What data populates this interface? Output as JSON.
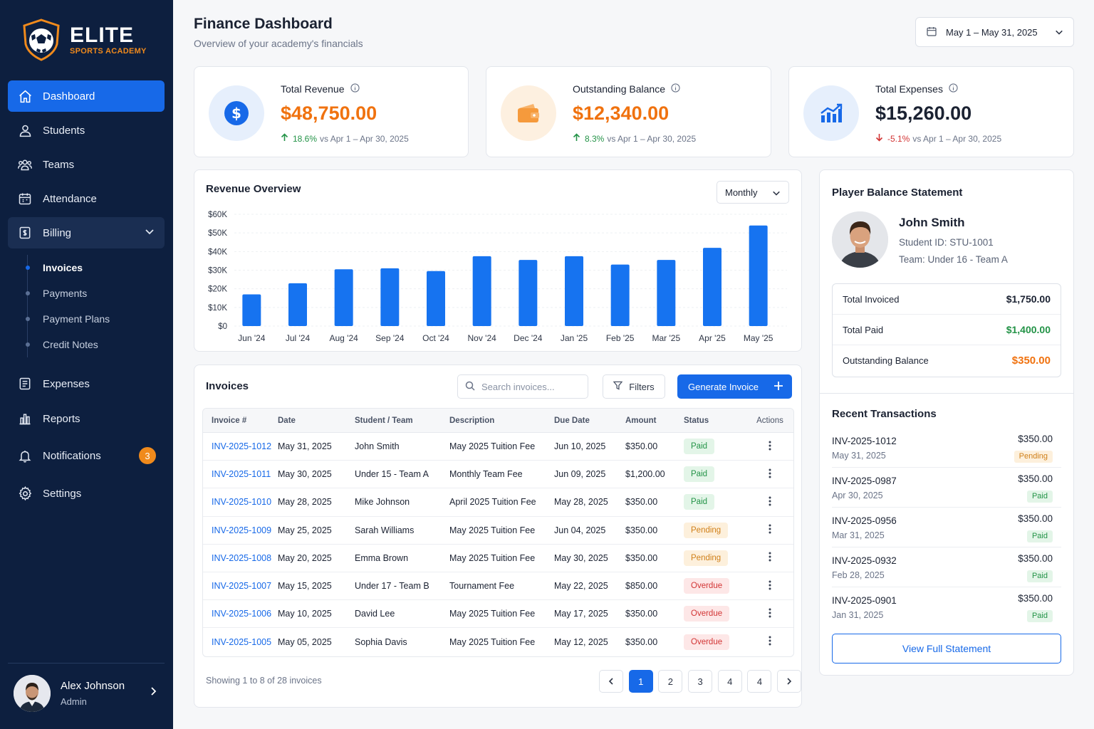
{
  "brand": {
    "name": "ELITE",
    "subtitle": "SPORTS ACADEMY"
  },
  "sidebar": {
    "items": [
      {
        "label": "Dashboard",
        "icon": "home-icon"
      },
      {
        "label": "Students",
        "icon": "user-icon"
      },
      {
        "label": "Teams",
        "icon": "users-icon"
      },
      {
        "label": "Attendance",
        "icon": "calendar-icon"
      },
      {
        "label": "Billing",
        "icon": "billing-icon"
      },
      {
        "label": "Expenses",
        "icon": "receipt-icon"
      },
      {
        "label": "Reports",
        "icon": "bar-chart-icon"
      },
      {
        "label": "Notifications",
        "icon": "bell-icon",
        "badge": "3"
      },
      {
        "label": "Settings",
        "icon": "gear-icon"
      }
    ],
    "billing_sub": [
      "Invoices",
      "Payments",
      "Payment Plans",
      "Credit Notes"
    ],
    "user": {
      "name": "Alex Johnson",
      "role": "Admin"
    }
  },
  "header": {
    "title": "Finance Dashboard",
    "subtitle": "Overview of your academy's financials",
    "date_range": "May 1 – May 31, 2025"
  },
  "stats": [
    {
      "label": "Total Revenue",
      "value": "$48,750.00",
      "change": "18.6%",
      "period": "vs Apr 1 – Apr 30, 2025",
      "direction": "up",
      "value_color": "#f0720f"
    },
    {
      "label": "Outstanding Balance",
      "value": "$12,340.00",
      "change": "8.3%",
      "period": "vs Apr 1 – Apr 30, 2025",
      "direction": "up",
      "value_color": "#f0720f"
    },
    {
      "label": "Total Expenses",
      "value": "$15,260.00",
      "change": "-5.1%",
      "period": "vs Apr 1 – Apr 30, 2025",
      "direction": "down",
      "value_color": "#1b2232"
    }
  ],
  "revenue": {
    "title": "Revenue Overview",
    "period_select": "Monthly"
  },
  "chart_data": {
    "type": "bar",
    "title": "Revenue Overview",
    "categories": [
      "Jun '24",
      "Jul '24",
      "Aug '24",
      "Sep '24",
      "Oct '24",
      "Nov '24",
      "Dec '24",
      "Jan '25",
      "Feb '25",
      "Mar '25",
      "Apr '25",
      "May '25"
    ],
    "values": [
      17000,
      23000,
      30500,
      31000,
      29500,
      37500,
      35500,
      37500,
      33000,
      35500,
      42000,
      54000
    ],
    "y_ticks": [
      "$0",
      "$10K",
      "$20K",
      "$30K",
      "$40K",
      "$50K",
      "$60K"
    ],
    "ylim": [
      0,
      60000
    ],
    "color": "#1673f0",
    "grid": true
  },
  "invoices": {
    "title": "Invoices",
    "search_placeholder": "Search invoices...",
    "filters_label": "Filters",
    "generate_label": "Generate Invoice",
    "columns": [
      "Invoice #",
      "Date",
      "Student / Team",
      "Description",
      "Due Date",
      "Amount",
      "Status",
      "Actions"
    ],
    "rows": [
      {
        "id": "INV-2025-1012",
        "date": "May 31, 2025",
        "student": "John Smith",
        "desc": "May 2025 Tuition Fee",
        "due": "Jun 10, 2025",
        "amount": "$350.00",
        "status": "Paid"
      },
      {
        "id": "INV-2025-1011",
        "date": "May 30, 2025",
        "student": "Under 15 - Team A",
        "desc": "Monthly Team Fee",
        "due": "Jun 09, 2025",
        "amount": "$1,200.00",
        "status": "Paid"
      },
      {
        "id": "INV-2025-1010",
        "date": "May 28, 2025",
        "student": "Mike Johnson",
        "desc": "April 2025 Tuition Fee",
        "due": "May 28, 2025",
        "amount": "$350.00",
        "status": "Paid"
      },
      {
        "id": "INV-2025-1009",
        "date": "May 25, 2025",
        "student": "Sarah Williams",
        "desc": "May 2025 Tuition Fee",
        "due": "Jun 04, 2025",
        "amount": "$350.00",
        "status": "Pending"
      },
      {
        "id": "INV-2025-1008",
        "date": "May 20, 2025",
        "student": "Emma Brown",
        "desc": "May 2025 Tuition Fee",
        "due": "May 30, 2025",
        "amount": "$350.00",
        "status": "Pending"
      },
      {
        "id": "INV-2025-1007",
        "date": "May 15, 2025",
        "student": "Under 17 - Team B",
        "desc": "Tournament Fee",
        "due": "May 22, 2025",
        "amount": "$850.00",
        "status": "Overdue"
      },
      {
        "id": "INV-2025-1006",
        "date": "May 10, 2025",
        "student": "David Lee",
        "desc": "May 2025 Tuition Fee",
        "due": "May 17, 2025",
        "amount": "$350.00",
        "status": "Overdue"
      },
      {
        "id": "INV-2025-1005",
        "date": "May 05, 2025",
        "student": "Sophia Davis",
        "desc": "May 2025 Tuition Fee",
        "due": "May 12, 2025",
        "amount": "$350.00",
        "status": "Overdue"
      }
    ],
    "showing": "Showing 1 to 8 of 28 invoices",
    "pages": [
      "1",
      "2",
      "3",
      "4",
      "4"
    ],
    "current_page": "1"
  },
  "statement": {
    "title": "Player Balance Statement",
    "name": "John Smith",
    "student_id": "Student ID: STU-1001",
    "team": "Team: Under 16 - Team A",
    "rows": [
      {
        "label": "Total Invoiced",
        "value": "$1,750.00",
        "color": "#1b2232"
      },
      {
        "label": "Total Paid",
        "value": "$1,400.00",
        "color": "#239347"
      },
      {
        "label": "Outstanding Balance",
        "value": "$350.00",
        "color": "#f0720f"
      }
    ],
    "recent_title": "Recent Transactions",
    "transactions": [
      {
        "id": "INV-2025-1012",
        "date": "May 31, 2025",
        "amount": "$350.00",
        "status": "Pending"
      },
      {
        "id": "INV-2025-0987",
        "date": "Apr 30, 2025",
        "amount": "$350.00",
        "status": "Paid"
      },
      {
        "id": "INV-2025-0956",
        "date": "Mar 31, 2025",
        "amount": "$350.00",
        "status": "Paid"
      },
      {
        "id": "INV-2025-0932",
        "date": "Feb 28, 2025",
        "amount": "$350.00",
        "status": "Paid"
      },
      {
        "id": "INV-2025-0901",
        "date": "Jan 31, 2025",
        "amount": "$350.00",
        "status": "Paid"
      }
    ],
    "view_label": "View Full Statement"
  },
  "colors": {
    "accent": "#1769e8",
    "sidebar": "#0d1f3f",
    "orange": "#f0720f",
    "green": "#239347",
    "red": "#d23434"
  }
}
